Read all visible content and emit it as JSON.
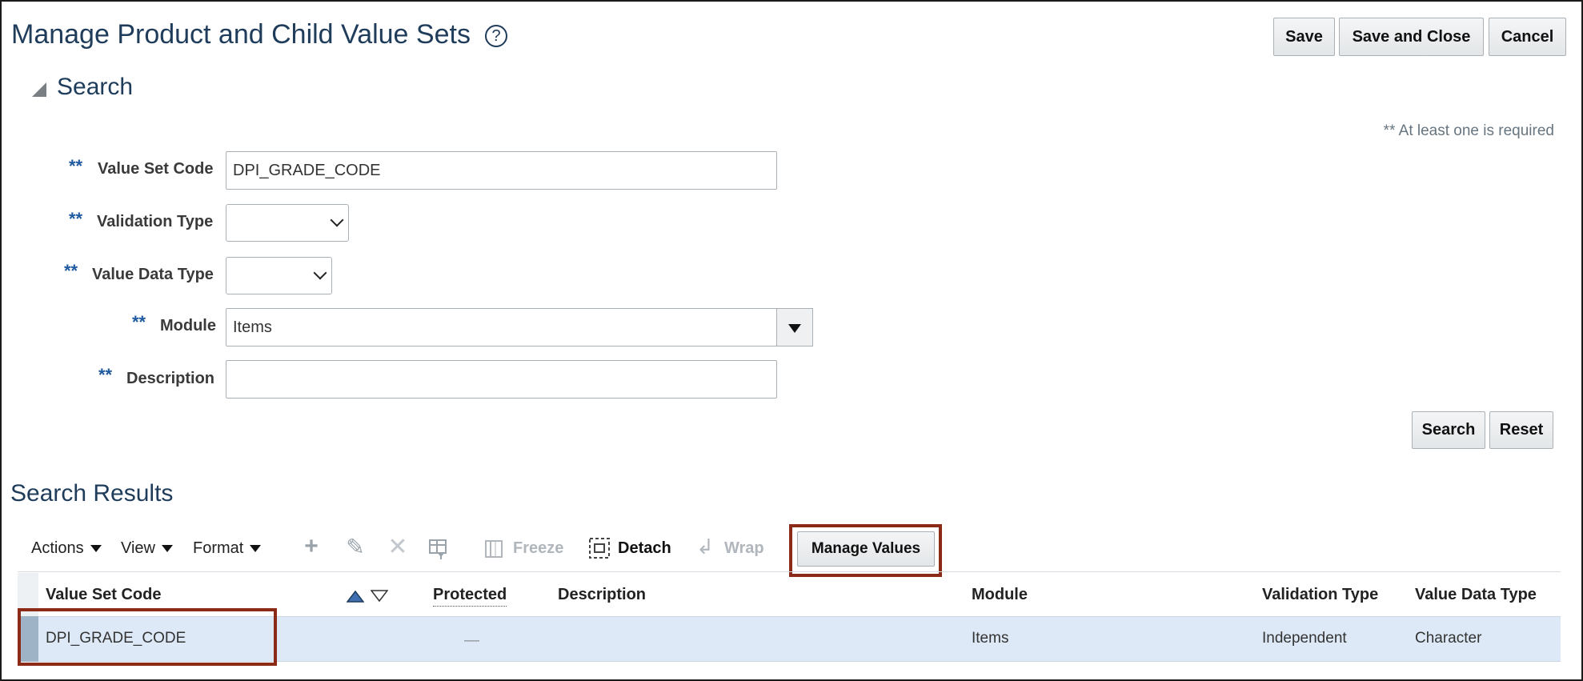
{
  "page": {
    "title": "Manage Product and Child Value Sets",
    "help_glyph": "?",
    "buttons": {
      "save": "Save",
      "save_and_close": "Save and Close",
      "cancel": "Cancel"
    }
  },
  "search": {
    "section_title": "Search",
    "required_note": "** At least one is required",
    "required_mark": "**",
    "fields": {
      "value_set_code": {
        "label": "Value Set Code",
        "value": "DPI_GRADE_CODE"
      },
      "validation_type": {
        "label": "Validation Type",
        "value": ""
      },
      "value_data_type": {
        "label": "Value Data Type",
        "value": ""
      },
      "module": {
        "label": "Module",
        "value": "Items"
      },
      "description": {
        "label": "Description",
        "value": ""
      }
    },
    "search_button": "Search",
    "reset_button": "Reset"
  },
  "results": {
    "section_title": "Search Results",
    "toolbar": {
      "actions": "Actions",
      "view": "View",
      "format": "Format",
      "freeze": "Freeze",
      "detach": "Detach",
      "wrap": "Wrap",
      "manage_values": "Manage Values"
    },
    "columns": [
      "Value Set Code",
      "Protected",
      "Description",
      "Module",
      "Validation Type",
      "Value Data Type"
    ],
    "rows": [
      {
        "value_set_code": "DPI_GRADE_CODE",
        "protected": "—",
        "description": "",
        "module": "Items",
        "validation_type": "Independent",
        "value_data_type": "Character"
      }
    ]
  },
  "colors": {
    "title": "#1f3c5a",
    "required_star": "#1f5aa0",
    "highlight_box": "#8b2a17",
    "selected_row": "#dde9f6"
  }
}
